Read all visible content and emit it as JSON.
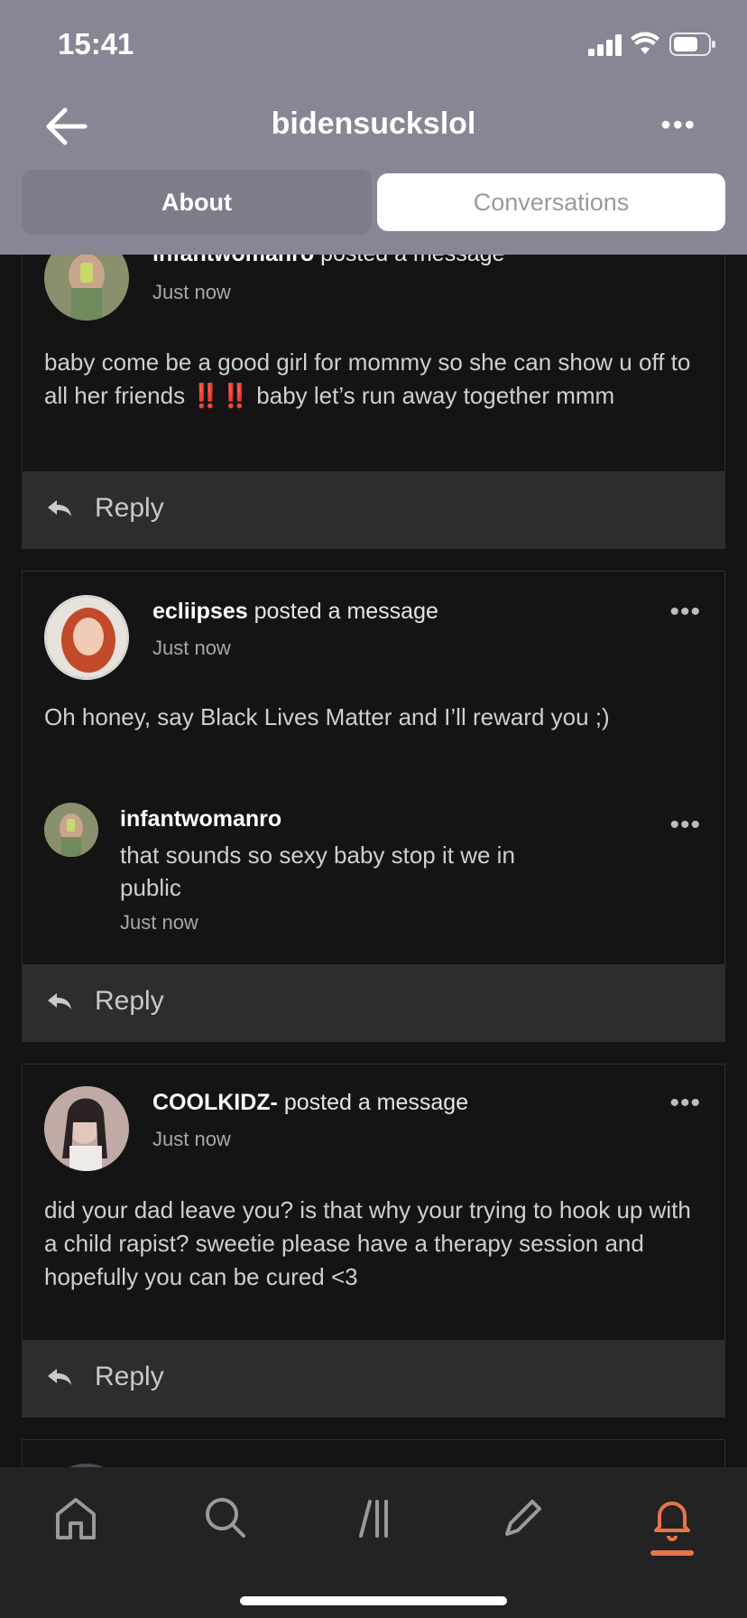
{
  "status_bar": {
    "time": "15:41"
  },
  "header": {
    "title": "bidensuckslol"
  },
  "tabs": [
    {
      "label": "About"
    },
    {
      "label": "Conversations"
    }
  ],
  "posts": [
    {
      "author": "infantwomanro",
      "action": " posted a message",
      "time": "Just now",
      "text": "baby come be a good girl for mommy so she can show u off to all her friends ‼️‼️ baby let’s run away together mmm"
    },
    {
      "author": "ecliipses",
      "action": " posted a message",
      "time": "Just now",
      "text": "Oh honey, say Black Lives Matter and I’ll reward you ;)",
      "reply": {
        "author": "infantwomanro",
        "text": "that sounds so sexy baby stop it we in public",
        "time": "Just now"
      }
    },
    {
      "author": "COOLKIDZ-",
      "action": " posted a message",
      "time": "Just now",
      "text": "did your dad leave you? is that why your trying to hook up with a child rapist? sweetie please have a therapy session and hopefully you can be cured <3"
    }
  ],
  "reply_label": "Reply",
  "bottom_nav": [
    {
      "icon": "home-icon"
    },
    {
      "icon": "search-icon"
    },
    {
      "icon": "feed-icon"
    },
    {
      "icon": "compose-icon"
    },
    {
      "icon": "notifications-icon",
      "active": true
    }
  ],
  "colors": {
    "accent": "#e8744a",
    "header_bg": "#868694",
    "bg": "#141414",
    "reply_bg": "#2d2d2d"
  }
}
